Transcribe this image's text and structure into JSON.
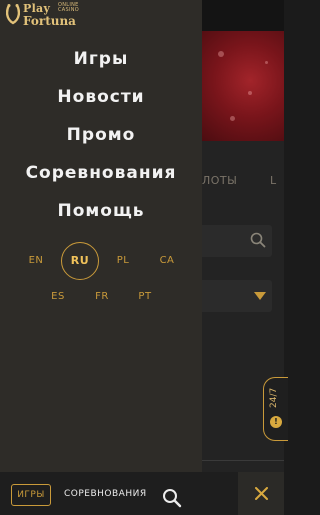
{
  "logo": {
    "play": "Play",
    "online_casino": "ONLINE CASINO",
    "fortuna": "Fortuna"
  },
  "menu": {
    "items": [
      {
        "label": "Игры"
      },
      {
        "label": "Новости"
      },
      {
        "label": "Промо"
      },
      {
        "label": "Соревнования"
      },
      {
        "label": "Помощь"
      }
    ]
  },
  "languages": {
    "row1": [
      "EN",
      "RU",
      "PL",
      "CA"
    ],
    "row2": [
      "ES",
      "FR",
      "PT"
    ],
    "selected": "RU"
  },
  "background": {
    "tab_partial_1": "ЛОТЫ",
    "tab_partial_2": "L"
  },
  "support": {
    "label": "24/7"
  },
  "bottom_bar": {
    "games_label": "ИГРЫ",
    "contests_label": "СОРЕВНОВАНИЯ",
    "search_icon": "search-icon",
    "close_icon": "close-icon"
  },
  "colors": {
    "accent": "#c99a3a",
    "drawer_bg": "#2e2c28",
    "menu_text": "#f2f2f2"
  }
}
